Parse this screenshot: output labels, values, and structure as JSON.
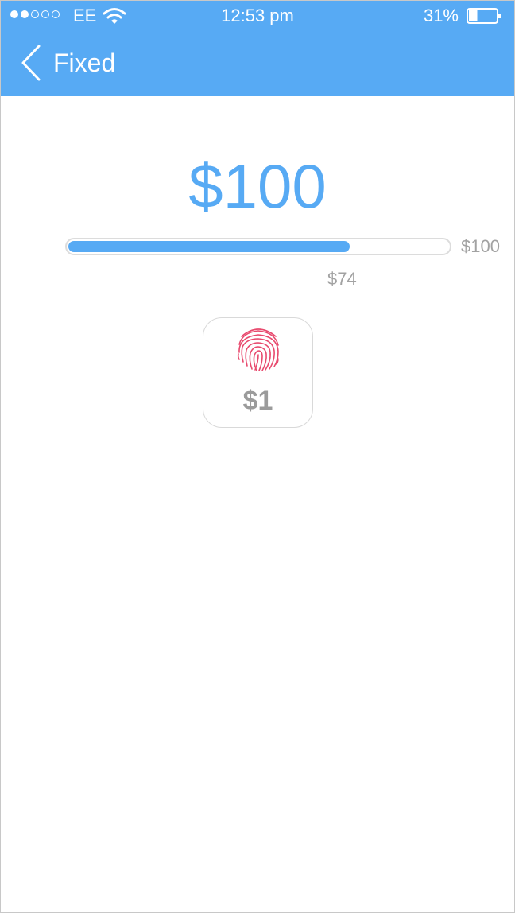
{
  "status_bar": {
    "signal_filled": 2,
    "signal_total": 5,
    "carrier": "EE",
    "time": "12:53 pm",
    "battery_percent": "31%",
    "battery_level": 0.31
  },
  "nav": {
    "back_label": "Fixed",
    "back_icon": "chevron-left-icon"
  },
  "amount": {
    "value": "$100"
  },
  "progress": {
    "current_label": "$74",
    "max_label": "$100",
    "fraction": 0.74
  },
  "tile": {
    "icon": "fingerprint-icon",
    "label": "$1"
  },
  "colors": {
    "accent": "#57aaf4",
    "fingerprint": "#e84a6e",
    "muted_text": "#9b9b9b"
  }
}
